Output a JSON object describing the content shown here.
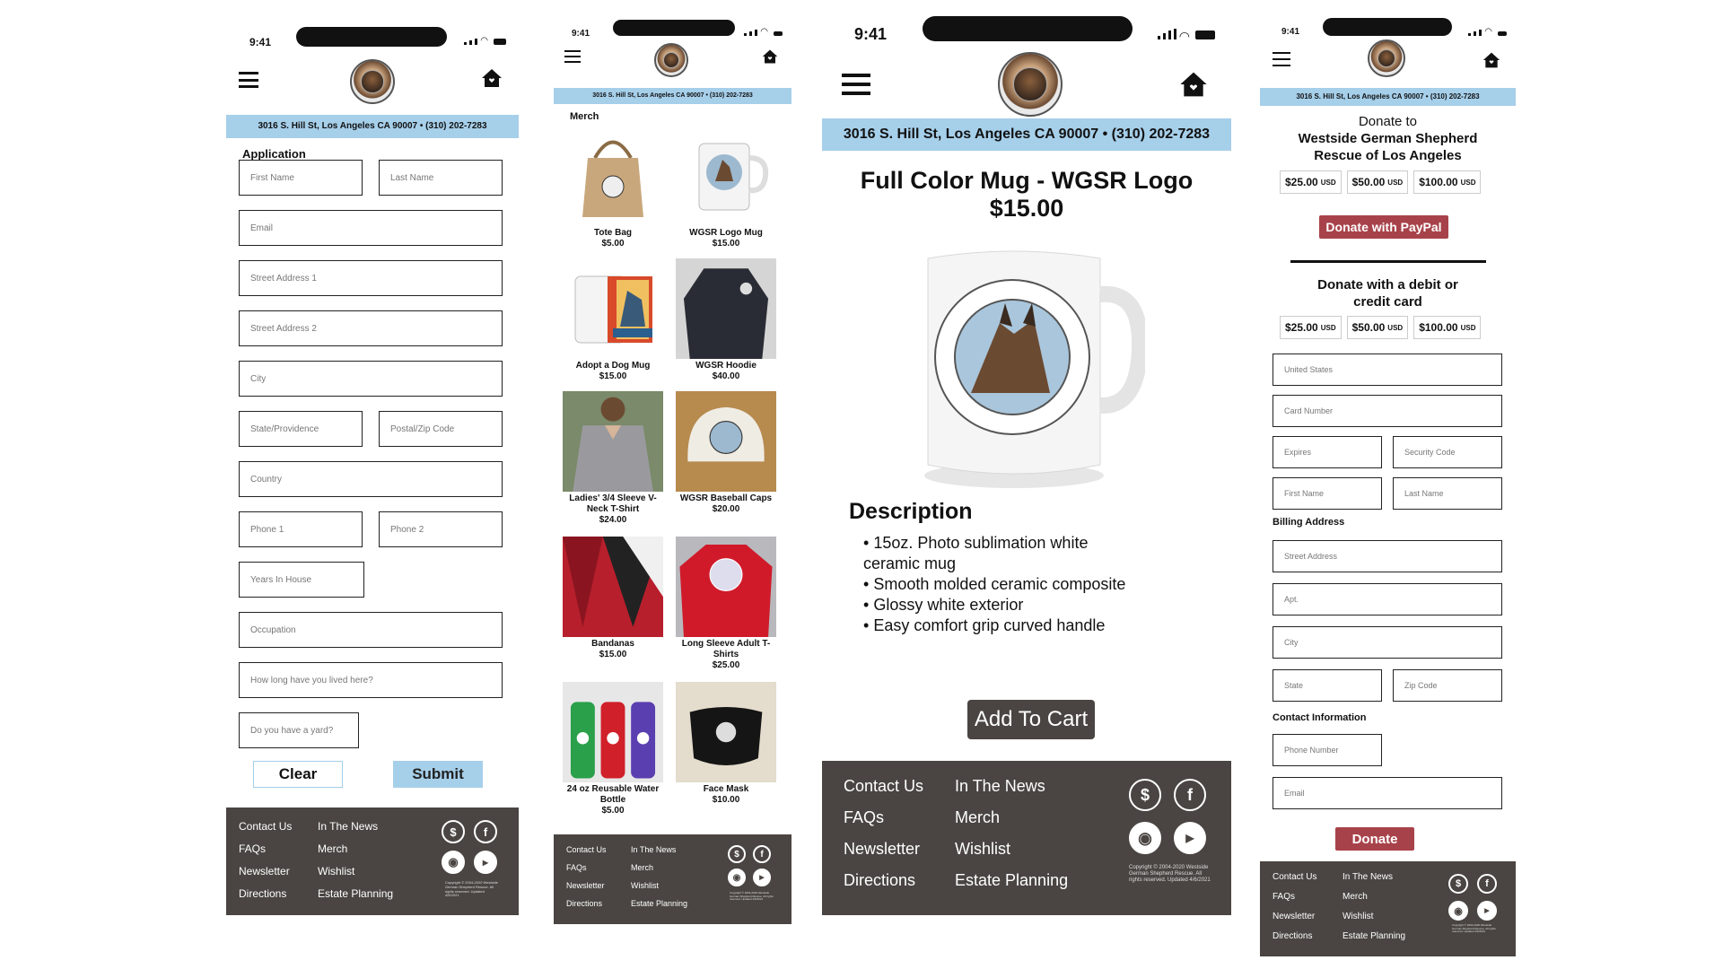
{
  "status": {
    "time": "9:41"
  },
  "address": "3016 S. Hill St, Los Angeles CA 90007 •  (310) 202-7283",
  "footer": {
    "col1": [
      "Contact Us",
      "FAQs",
      "Newsletter",
      "Directions"
    ],
    "col2": [
      "In The News",
      "Merch",
      "Wishlist",
      "Estate Planning"
    ],
    "copyright": "Copyright © 2004-2020 Westside German Shepherd Rescue. All rights reserved. Updated 4/6/2021",
    "icons": [
      "dollar-icon",
      "facebook-icon",
      "instagram-icon",
      "youtube-icon"
    ]
  },
  "application": {
    "title": "Application",
    "fields": {
      "first_name": "First Name",
      "last_name": "Last Name",
      "email": "Email",
      "street1": "Street Address 1",
      "street2": "Street Address 2",
      "city": "City",
      "state": "State/Providence",
      "zip": "Postal/Zip Code",
      "country": "Country",
      "phone1": "Phone 1",
      "phone2": "Phone 2",
      "years": "Years In House",
      "occupation": "Occupation",
      "how_long": "How long have you lived here?",
      "yard": "Do you have a yard?"
    },
    "clear": "Clear",
    "submit": "Submit"
  },
  "merch": {
    "title": "Merch",
    "products": [
      {
        "name": "Tote Bag",
        "price": "$5.00"
      },
      {
        "name": "WGSR Logo Mug",
        "price": "$15.00"
      },
      {
        "name": "Adopt a Dog Mug",
        "price": "$15.00"
      },
      {
        "name": "WGSR Hoodie",
        "price": "$40.00"
      },
      {
        "name": "Ladies' 3/4 Sleeve V-Neck T-Shirt",
        "price": "$24.00"
      },
      {
        "name": "WGSR Baseball Caps",
        "price": "$20.00"
      },
      {
        "name": "Bandanas",
        "price": "$15.00"
      },
      {
        "name": "Long Sleeve Adult T-Shirts",
        "price": "$25.00"
      },
      {
        "name": "24 oz Reusable Water Bottle",
        "price": "$5.00"
      },
      {
        "name": "Face Mask",
        "price": "$10.00"
      }
    ]
  },
  "product": {
    "title": "Full Color Mug - WGSR Logo",
    "price": "$15.00",
    "desc_heading": "Description",
    "bullets": [
      "15oz. Photo sublimation white ceramic mug",
      "Smooth molded ceramic composite",
      "Glossy white exterior",
      "Easy comfort grip curved handle"
    ],
    "add_to_cart": "Add To Cart"
  },
  "donate": {
    "title_light": "Donate to",
    "title_bold": "Westside German Shepherd Rescue of Los Angeles",
    "amounts": [
      "$25.00",
      "$50.00",
      "$100.00"
    ],
    "currency": "USD",
    "paypal": "Donate with PayPal",
    "card_title": "Donate with a debit or credit card",
    "fields": {
      "country": "United States",
      "card": "Card Number",
      "expires": "Expires",
      "security": "Security Code",
      "first": "First Name",
      "last": "Last Name",
      "street": "Street Address",
      "apt": "Apt.",
      "city": "City",
      "state": "State",
      "zip": "Zip Code",
      "phone": "Phone Number",
      "email": "Email"
    },
    "billing": "Billing Address",
    "contact": "Contact Information",
    "donate": "Donate"
  }
}
